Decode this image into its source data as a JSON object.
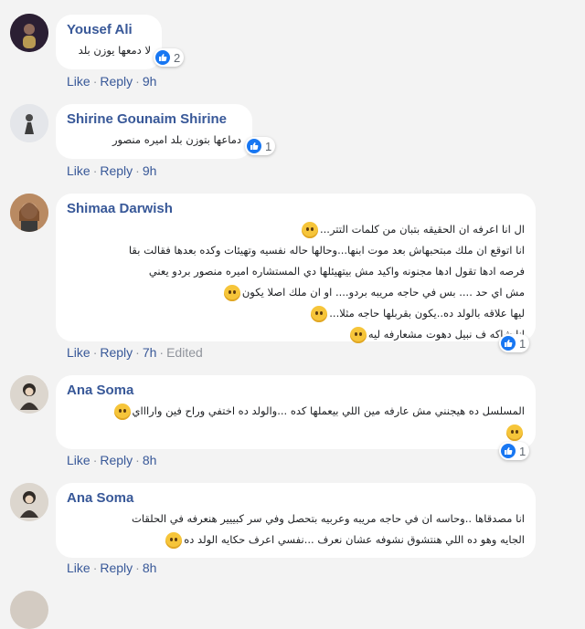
{
  "colors": {
    "author": "#385898",
    "meta": "#90949c",
    "bubble": "#ffffff",
    "background": "#f3f3f3",
    "like": "#1877f2"
  },
  "action_labels": {
    "like": "Like",
    "reply": "Reply",
    "separator": "·"
  },
  "comments": [
    {
      "author": "Yousef Ali",
      "lines": [
        "لا دمعها يوزن بلد"
      ],
      "reactions": "2",
      "time": "9h"
    },
    {
      "author": "Shirine Gounaim Shirine",
      "lines": [
        "دماعها بتوزن بلد اميره منصور"
      ],
      "reactions": "1",
      "time": "9h"
    },
    {
      "author": "Shimaa Darwish",
      "lines": [
        "ال انا اعرفه ان الحقيقه بتبان من كلمات التتر...",
        "انا اتوقع ان ملك مبتحبهاش بعد موت ابنها...وحالها حاله نفسيه وتهيئات وكده بعدها فقالت بقا",
        "فرصه ادها تقول ادها مجنونه واكيد مش بيتهيئلها دي المستشاره اميره منصور بردو يعني",
        "مش اي حد .... بس في حاجه مريبه بردو.... او ان ملك اصلا يكون",
        "ليها علاقه بالولد ده..يكون بقربلها حاجه مثلا...",
        "انا شاكه ف نبيل دهوت مشعارفه ليه"
      ],
      "reactions": "1",
      "time": "7h",
      "edited": "Edited"
    },
    {
      "author": "Ana Soma",
      "lines": [
        "المسلسل ده هيجنني مش عارفه مين اللي بيعملها كده ...والولد ده اختفي وراح فين واراااي"
      ],
      "reactions": "1",
      "time": "8h"
    },
    {
      "author": "Ana Soma",
      "lines": [
        "انا مصدقاها ..وحاسه ان في حاجه مريبه وعربيه بتحصل وفي سر كبييير هنعرفه في الحلقات",
        "الجايه وهو ده اللي هنتشوق نشوفه عشان نعرف ...نفسي اعرف حكايه الولد ده"
      ],
      "time": "8h"
    }
  ]
}
